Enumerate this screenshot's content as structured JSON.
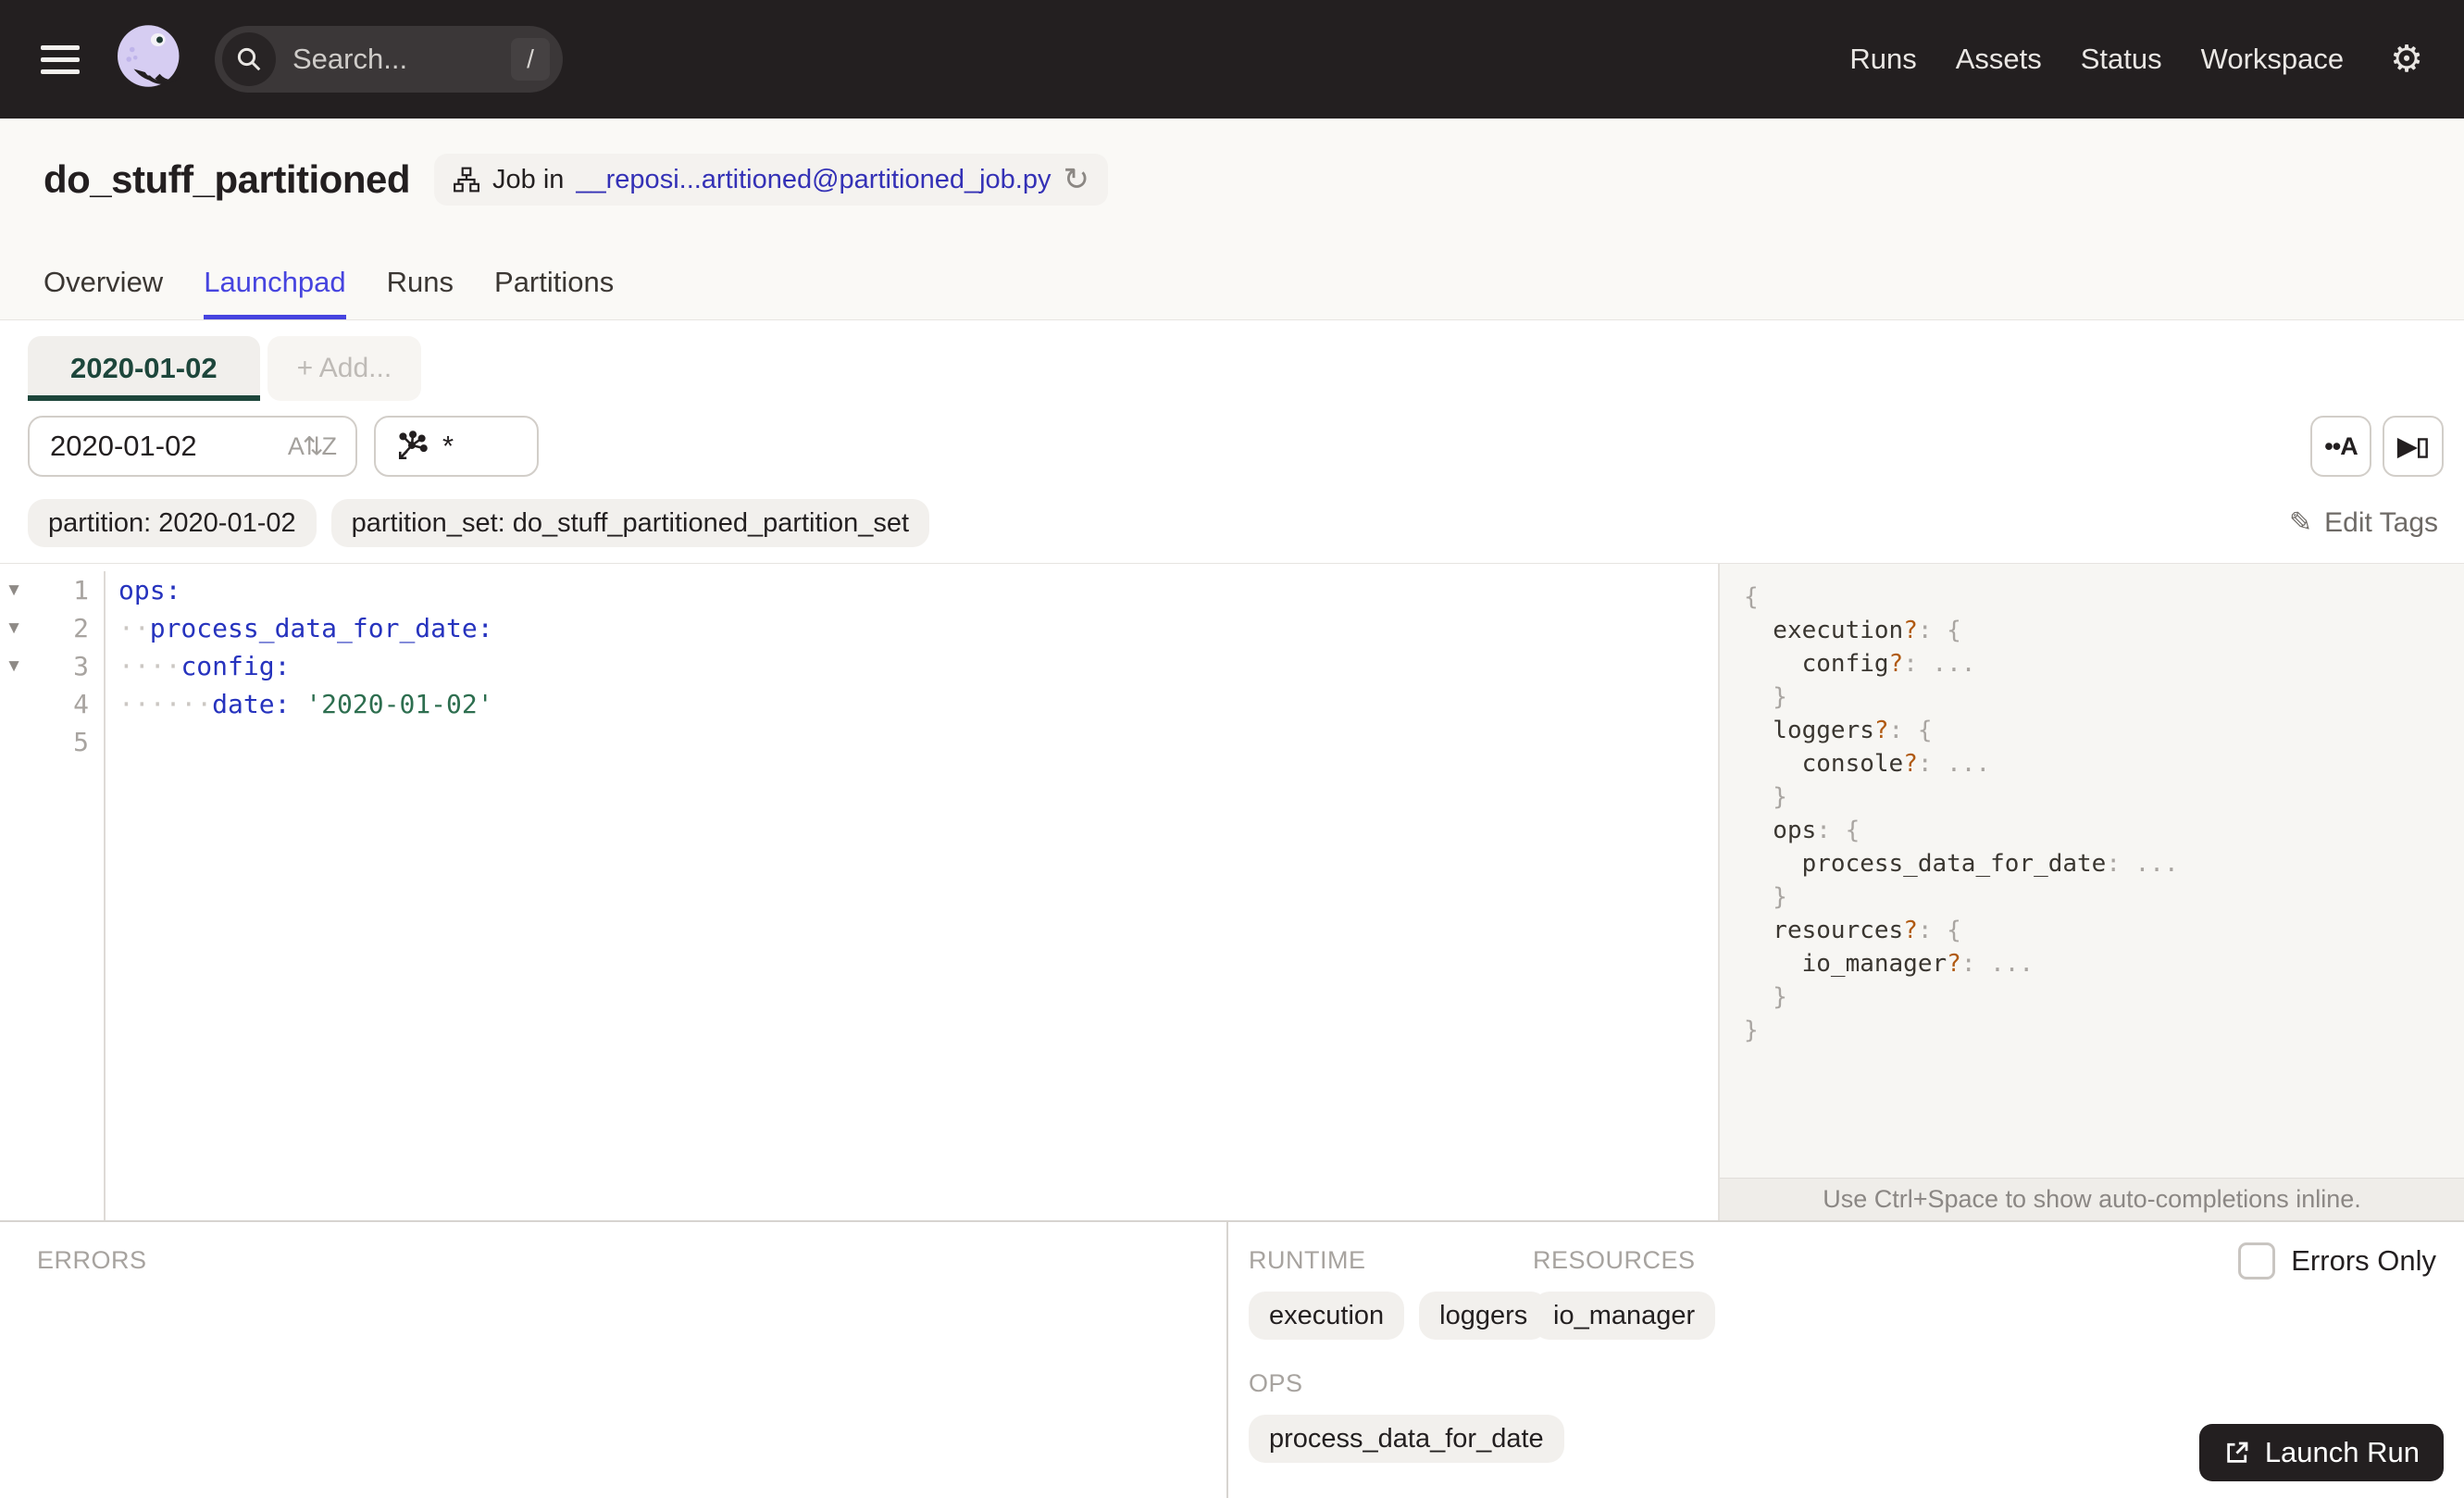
{
  "colors": {
    "navbar_bg": "#231F20",
    "accent_indigo": "#4644DF",
    "badge_link_blue": "#3431B6",
    "partition_green": "#1D463B",
    "code_key_blue": "#2633BE",
    "code_string_green": "#2D6E4F",
    "schema_optional_orange": "#B05A12",
    "chip_bg": "#F2F0ED"
  },
  "navbar": {
    "search": {
      "placeholder": "Search...",
      "shortcut": "/"
    },
    "links": [
      "Runs",
      "Assets",
      "Status",
      "Workspace"
    ],
    "icons": {
      "menu": "hamburger",
      "logo": "dagster-octopus",
      "search": "magnifier",
      "settings": "gear"
    }
  },
  "header": {
    "title": "do_stuff_partitioned",
    "job_badge": {
      "prefix": "Job in",
      "link_text": "__reposi...artitioned@partitioned_job.py",
      "refresh_glyph": "↻"
    },
    "tabs": [
      {
        "label": "Overview",
        "active": false
      },
      {
        "label": "Launchpad",
        "active": true
      },
      {
        "label": "Runs",
        "active": false
      },
      {
        "label": "Partitions",
        "active": false
      }
    ]
  },
  "launchpad": {
    "partition_tab": "2020-01-02",
    "add_tab": "+ Add...",
    "partition_input_value": "2020-01-02",
    "sort_icon_glyph": "A⇅Z",
    "op_selector_value": "*",
    "editor_buttons": {
      "autocomplete_glyph": "••A",
      "scaffold_glyph": "▶▯"
    },
    "tags": [
      "partition: 2020-01-02",
      "partition_set: do_stuff_partitioned_partition_set"
    ],
    "edit_tags_label": "Edit Tags",
    "pencil_glyph": "✎"
  },
  "editor": {
    "lines": [
      {
        "num": "1",
        "fold": true,
        "dots": 0,
        "key": "ops:",
        "value": ""
      },
      {
        "num": "2",
        "fold": true,
        "dots": 2,
        "key": "process_data_for_date:",
        "value": ""
      },
      {
        "num": "3",
        "fold": true,
        "dots": 4,
        "key": "config:",
        "value": ""
      },
      {
        "num": "4",
        "fold": false,
        "dots": 6,
        "key": "date:",
        "value": " '2020-01-02'"
      },
      {
        "num": "5",
        "fold": false,
        "dots": 0,
        "key": "",
        "value": ""
      }
    ],
    "fold_glyph": "▼"
  },
  "schema": {
    "lines": [
      {
        "indent": 0,
        "key": "",
        "optional": false,
        "tail": "{"
      },
      {
        "indent": 1,
        "key": "execution",
        "optional": true,
        "tail": "{"
      },
      {
        "indent": 2,
        "key": "config",
        "optional": true,
        "tail": "..."
      },
      {
        "indent": 1,
        "key": "",
        "optional": false,
        "tail": "}"
      },
      {
        "indent": 1,
        "key": "loggers",
        "optional": true,
        "tail": "{"
      },
      {
        "indent": 2,
        "key": "console",
        "optional": true,
        "tail": "..."
      },
      {
        "indent": 1,
        "key": "",
        "optional": false,
        "tail": "}"
      },
      {
        "indent": 1,
        "key": "ops",
        "optional": false,
        "tail": "{"
      },
      {
        "indent": 2,
        "key": "process_data_for_date",
        "optional": false,
        "tail": "..."
      },
      {
        "indent": 1,
        "key": "",
        "optional": false,
        "tail": "}"
      },
      {
        "indent": 1,
        "key": "resources",
        "optional": true,
        "tail": "{"
      },
      {
        "indent": 2,
        "key": "io_manager",
        "optional": true,
        "tail": "..."
      },
      {
        "indent": 1,
        "key": "",
        "optional": false,
        "tail": "}"
      },
      {
        "indent": 0,
        "key": "",
        "optional": false,
        "tail": "}"
      }
    ],
    "hint": "Use Ctrl+Space to show auto-completions inline."
  },
  "bottom": {
    "errors_label": "ERRORS",
    "groups": [
      {
        "label": "RUNTIME",
        "chips": [
          "execution",
          "loggers"
        ]
      },
      {
        "label": "RESOURCES",
        "chips": [
          "io_manager"
        ]
      },
      {
        "label": "OPS",
        "chips": [
          "process_data_for_date"
        ]
      }
    ],
    "errors_only_label": "Errors Only",
    "launch_button_label": "Launch Run"
  }
}
